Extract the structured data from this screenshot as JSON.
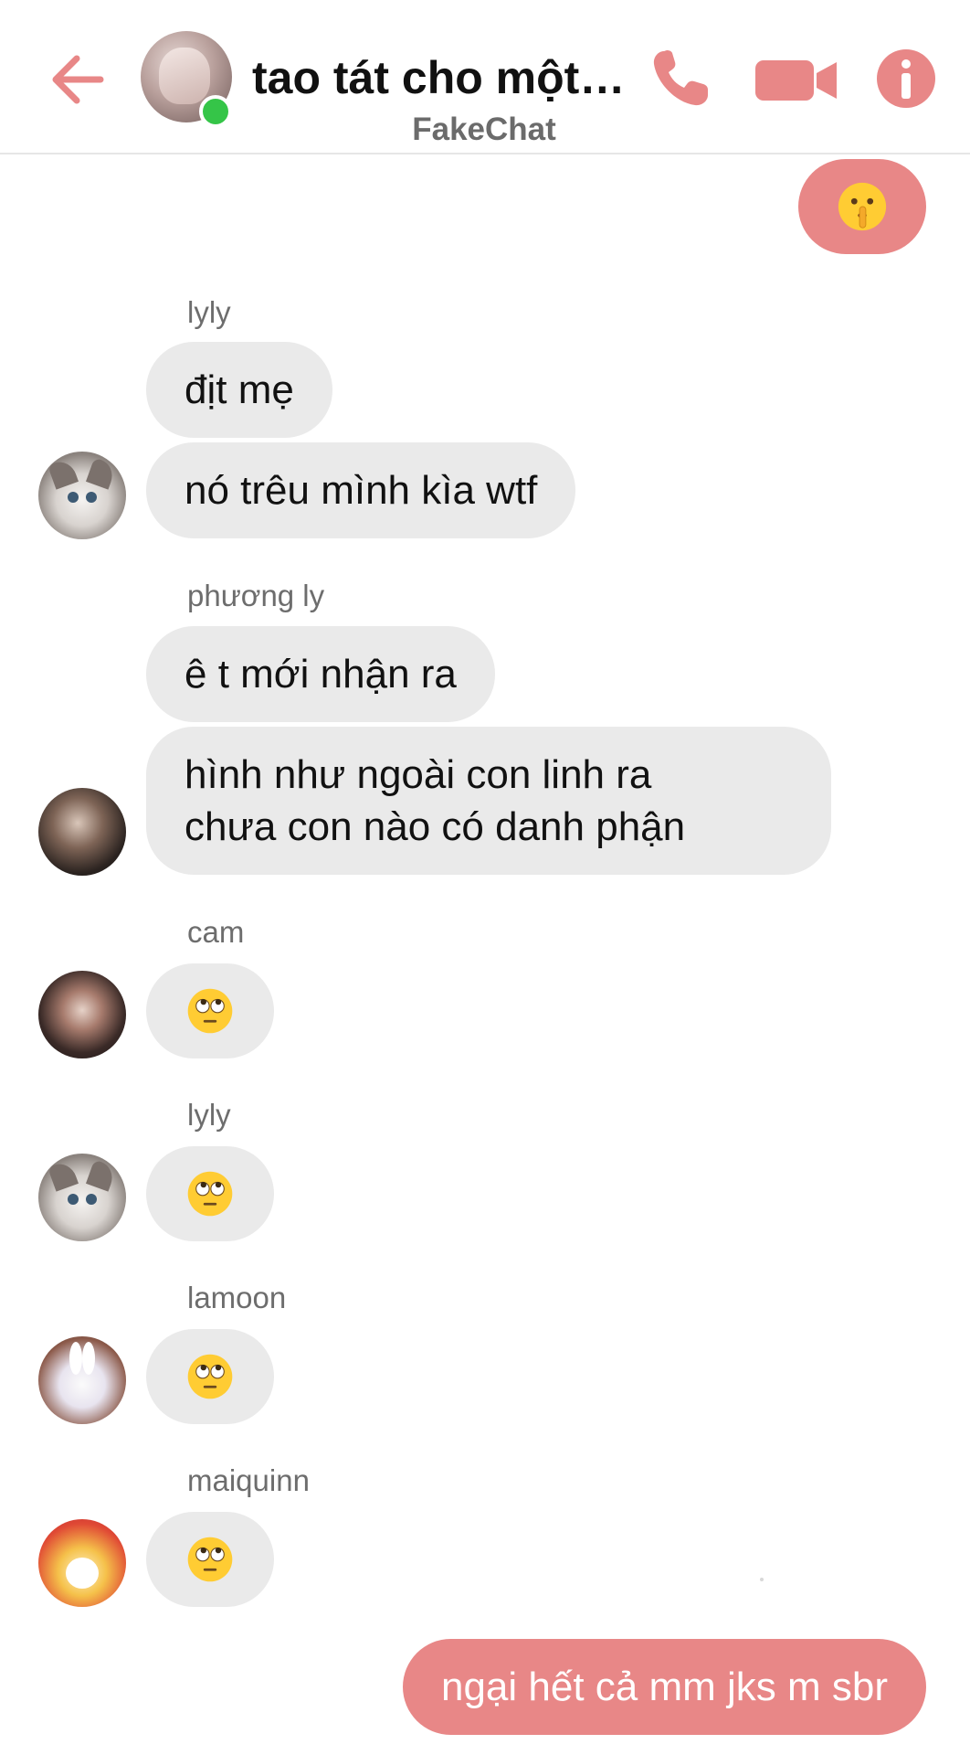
{
  "header": {
    "title": "tao tát cho một ...",
    "subtitle": "FakeChat",
    "accent_color": "#e88787",
    "online_color": "#35c548",
    "icons": [
      "arrow-left-icon",
      "phone-icon",
      "video-camera-icon",
      "info-icon"
    ]
  },
  "messages": {
    "out_1": {
      "emoji": "shushing-face"
    },
    "lyly_1": {
      "sender": "lyly",
      "text_1": "địt mẹ",
      "text_2": "nó trêu mình kìa wtf"
    },
    "phuongly": {
      "sender": "phương ly",
      "text_1": "ê t mới nhận ra",
      "text_2_line_1": "hình như ngoài con linh ra",
      "text_2_line_2": "chưa con nào có danh phận"
    },
    "cam": {
      "sender": "cam",
      "emoji": "face-with-rolling-eyes"
    },
    "lyly_2": {
      "sender": "lyly",
      "emoji": "face-with-rolling-eyes"
    },
    "lamoon": {
      "sender": "lamoon",
      "emoji": "face-with-rolling-eyes"
    },
    "maiquinn": {
      "sender": "maiquinn",
      "emoji": "face-with-rolling-eyes"
    },
    "out_2": {
      "text": "ngại hết cả mm jks m sbr"
    }
  },
  "colors": {
    "incoming_bubble": "#eaeaea",
    "outgoing_bubble": "#e88787",
    "sender_name": "#6d6d6d"
  }
}
